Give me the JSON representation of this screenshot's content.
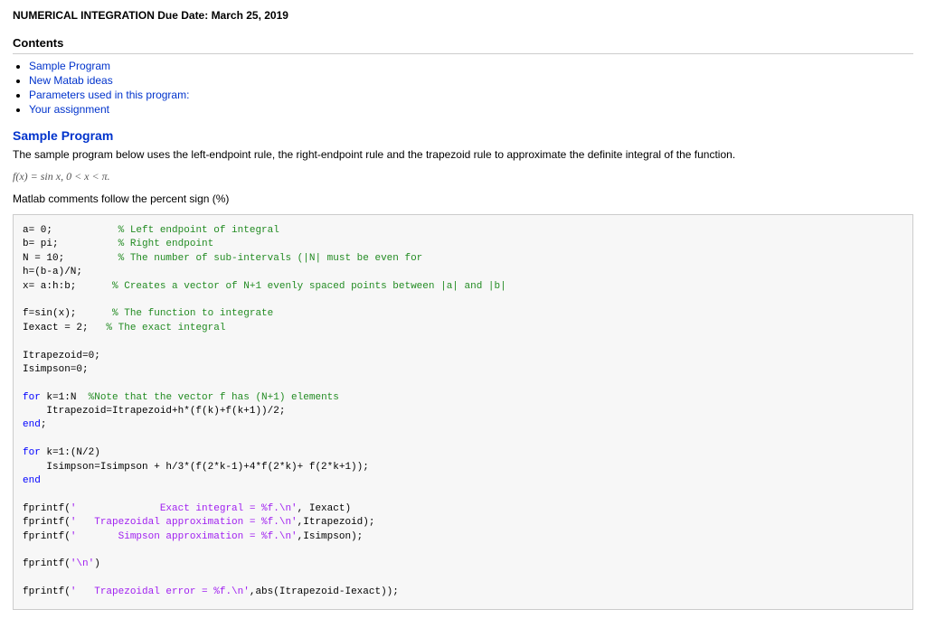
{
  "title": "NUMERICAL INTEGRATION Due Date: March 25, 2019",
  "contents_heading": "Contents",
  "toc": [
    "Sample Program",
    "New Matab ideas",
    "Parameters used in this program:",
    "Your assignment"
  ],
  "sample_program_heading": "Sample Program",
  "sample_program_intro": "The sample program below uses the left-endpoint rule, the right-endpoint rule and the trapezoid rule to approximate the definite integral of the function.",
  "math_expr": "f(x) = sin x, 0 < x < π.",
  "matlab_comment_note": "Matlab comments follow the percent sign (%)",
  "code": {
    "l1_a": "a= 0;           ",
    "l1_c": "% Left endpoint of integral",
    "l2_a": "b= pi;          ",
    "l2_c": "% Right endpoint",
    "l3_a": "N = 10;         ",
    "l3_c": "% The number of sub-intervals (|N| must be even for",
    "l4": "h=(b-a)/N;",
    "l5_a": "x= a:h:b;      ",
    "l5_c": "% Creates a vector of N+1 evenly spaced points between |a| and |b|",
    "l6_a": "f=sin(x);      ",
    "l6_c": "% The function to integrate",
    "l7_a": "Iexact = 2;   ",
    "l7_c": "% The exact integral",
    "l8": "Itrapezoid=0;",
    "l9": "Isimpson=0;",
    "l10_kw": "for",
    "l10_a": " k=1:N  ",
    "l10_c": "%Note that the vector f has (N+1) elements",
    "l11": "    Itrapezoid=Itrapezoid+h*(f(k)+f(k+1))/2;",
    "l12_kw": "end",
    "l12_a": ";",
    "l13_kw": "for",
    "l13_a": " k=1:(N/2)",
    "l14": "    Isimpson=Isimpson + h/3*(f(2*k-1)+4*f(2*k)+ f(2*k+1));",
    "l15_kw": "end",
    "l16_a": "fprintf(",
    "l16_s": "'              Exact integral = %f.\\n'",
    "l16_b": ", Iexact)",
    "l17_a": "fprintf(",
    "l17_s": "'   Trapezoidal approximation = %f.\\n'",
    "l17_b": ",Itrapezoid);",
    "l18_a": "fprintf(",
    "l18_s": "'       Simpson approximation = %f.\\n'",
    "l18_b": ",Isimpson);",
    "l19_a": "fprintf(",
    "l19_s": "'\\n'",
    "l19_b": ")",
    "l20_a": "fprintf(",
    "l20_s": "'   Trapezoidal error = %f.\\n'",
    "l20_b": ",abs(Itrapezoid-Iexact));"
  }
}
